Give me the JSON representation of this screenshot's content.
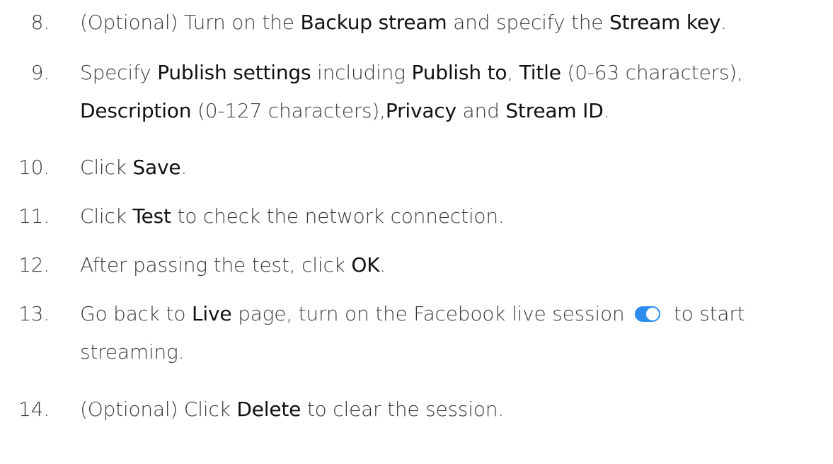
{
  "steps": [
    {
      "number": "8.",
      "parts": [
        {
          "text": "(Optional) Turn on the "
        },
        {
          "text": "Backup stream",
          "bold": true
        },
        {
          "text": " and specify the "
        },
        {
          "text": "Stream key",
          "bold": true
        },
        {
          "text": "."
        }
      ]
    },
    {
      "number": "9.",
      "parts": [
        {
          "text": "Specify "
        },
        {
          "text": "Publish settings",
          "bold": true
        },
        {
          "text": " including "
        },
        {
          "text": "Publish to",
          "bold": true
        },
        {
          "text": ", "
        },
        {
          "text": "Title",
          "bold": true
        },
        {
          "text": " (0-63 characters),"
        }
      ],
      "line2": [
        {
          "text": "Description",
          "bold": true
        },
        {
          "text": " (0-127 characters),"
        },
        {
          "text": "Privacy",
          "bold": true
        },
        {
          "text": " and "
        },
        {
          "text": "Stream ID",
          "bold": true
        },
        {
          "text": "."
        }
      ]
    },
    {
      "number": "10.",
      "parts": [
        {
          "text": "Click "
        },
        {
          "text": "Save",
          "bold": true
        },
        {
          "text": "."
        }
      ]
    },
    {
      "number": "11.",
      "parts": [
        {
          "text": "Click "
        },
        {
          "text": "Test",
          "bold": true
        },
        {
          "text": " to check the network connection."
        }
      ]
    },
    {
      "number": "12.",
      "parts": [
        {
          "text": "After passing the test, click "
        },
        {
          "text": "OK",
          "bold": true
        },
        {
          "text": "."
        }
      ]
    },
    {
      "number": "13.",
      "parts": [
        {
          "text": "Go back to "
        },
        {
          "text": "Live",
          "bold": true
        },
        {
          "text": " page, turn on the Facebook live session "
        },
        {
          "toggle": "toggle-on-icon"
        },
        {
          "text": " to start"
        }
      ],
      "line2": [
        {
          "text": "streaming."
        }
      ]
    },
    {
      "number": "14.",
      "parts": [
        {
          "text": "(Optional) Click "
        },
        {
          "text": "Delete",
          "bold": true
        },
        {
          "text": " to clear the session."
        }
      ]
    }
  ],
  "colors": {
    "text": "#3a3a3a",
    "emphasis": "#111111",
    "toggle_on": "#2d8cf0"
  }
}
